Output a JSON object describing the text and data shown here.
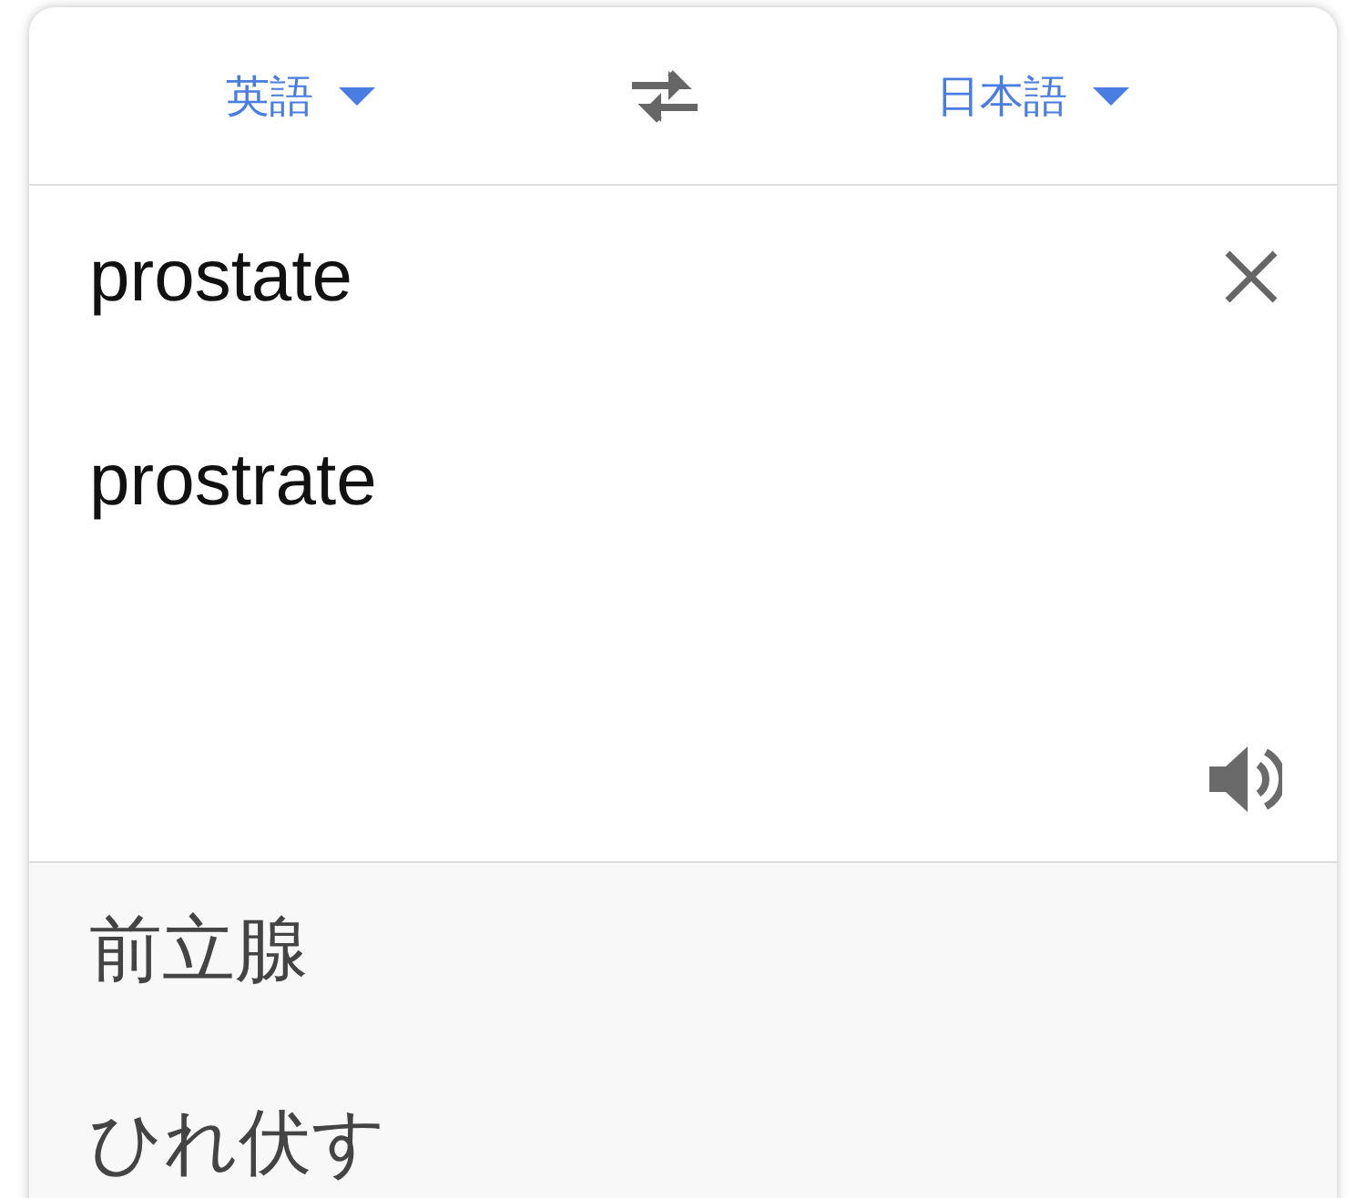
{
  "languages": {
    "source": {
      "label": "英語"
    },
    "target": {
      "label": "日本語"
    }
  },
  "input": {
    "value": "prostate",
    "suggestion": "prostrate"
  },
  "translations": [
    "前立腺",
    "ひれ伏す"
  ]
}
